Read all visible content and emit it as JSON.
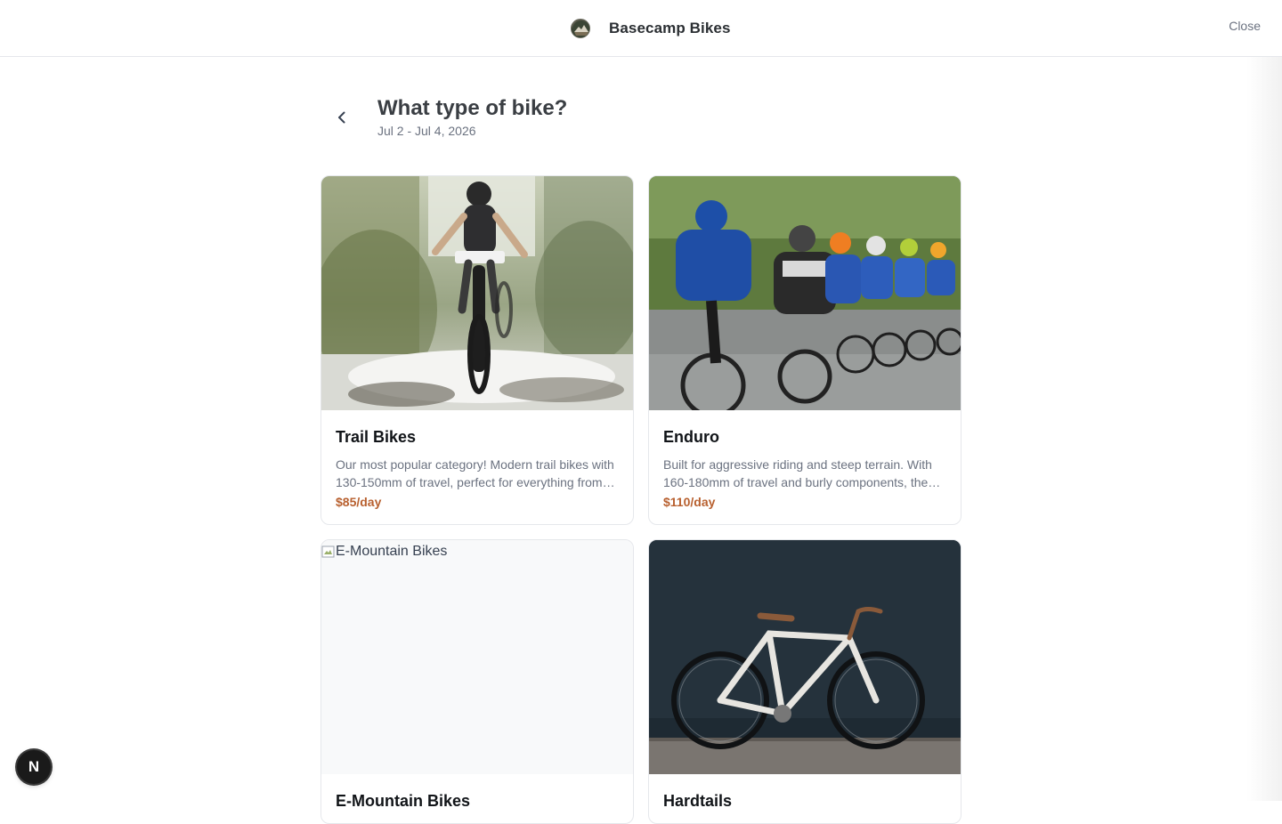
{
  "topbar": {
    "brand_name": "Basecamp Bikes",
    "close_label": "Close"
  },
  "header": {
    "title": "What type of bike?",
    "date_range": "Jul 2 - Jul 4, 2026"
  },
  "cards": [
    {
      "title": "Trail Bikes",
      "description": "Our most popular category! Modern trail bikes with 130-150mm of travel, perfect for everything from flowy singletrack to technical climbs.",
      "price": "$85/day",
      "image": "mountain-biker-splashing-through-stream"
    },
    {
      "title": "Enduro",
      "description": "Built for aggressive riding and steep terrain. With 160-180mm of travel and burly components, these bikes handle the roughest descents.",
      "price": "$110/day",
      "image": "road-cycling-peloton"
    },
    {
      "title": "E-Mountain Bikes",
      "image_alt": "E-Mountain Bikes",
      "image": "broken-image"
    },
    {
      "title": "Hardtails",
      "image": "white-bike-against-dark-wall"
    }
  ],
  "badge": {
    "letter": "N"
  },
  "colors": {
    "price": "#b8602f",
    "border": "#e5e7eb",
    "muted_text": "#6b7280"
  }
}
